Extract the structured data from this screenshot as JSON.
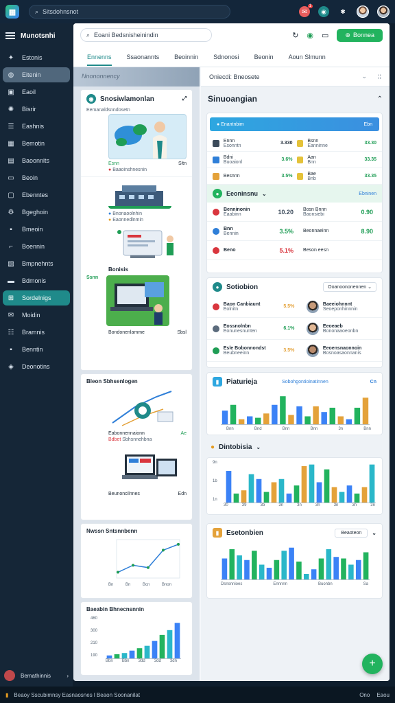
{
  "topbar": {
    "search_text": "Sitsdohnsnot",
    "notif_count": "1"
  },
  "sidebar": {
    "title": "Munotsnhi",
    "items": [
      {
        "label": "Estonis",
        "icon": "chart-icon"
      },
      {
        "label": "Eitenin",
        "icon": "circle-icon"
      },
      {
        "label": "Eaoil",
        "icon": "card-icon"
      },
      {
        "label": "Bisrir",
        "icon": "lightbulb-icon"
      },
      {
        "label": "Eashnis",
        "icon": "list-icon"
      },
      {
        "label": "Bemotin",
        "icon": "calendar-icon"
      },
      {
        "label": "Baoonnits",
        "icon": "doc-icon"
      },
      {
        "label": "Beoin",
        "icon": "monitor-icon"
      },
      {
        "label": "Ebenntes",
        "icon": "file-icon"
      },
      {
        "label": "Bgeghoin",
        "icon": "cog-icon"
      },
      {
        "label": "Bmeoin",
        "icon": "box-icon"
      },
      {
        "label": "Boennin",
        "icon": "key-icon"
      },
      {
        "label": "Bmpnehnts",
        "icon": "image-icon"
      },
      {
        "label": "Bdmonis",
        "icon": "folder-icon"
      },
      {
        "label": "Sordelnigs",
        "icon": "graph-icon"
      },
      {
        "label": "Moidin",
        "icon": "mail-icon"
      },
      {
        "label": "Bramnis",
        "icon": "users-icon"
      },
      {
        "label": "Benntin",
        "icon": "box-icon"
      },
      {
        "label": "Deonotins",
        "icon": "tag-icon"
      }
    ],
    "footer_label": "Bemathinnis"
  },
  "main": {
    "search_text": "Eoani Bedsnisheinindin",
    "action_button": "Bonnea",
    "tabs": [
      "Ennenns",
      "Ssaonannts",
      "Beoinnin",
      "Sdnonosi",
      "Beonin",
      "Aoun Slmunn"
    ],
    "left_banner": "Nnononnency",
    "right_header": "Oniecdi: Bneosete",
    "left_card_title": "Snosiwlamonlan",
    "left_items": [
      {
        "caption": "Eemanaldsnndosetn",
        "value": "Esnn",
        "sub": "Baaoinshnesnin",
        "sub2": "Sltn"
      },
      {
        "caption": "Bnonaoolnhin",
        "sub": "Eaonnedlnmin"
      },
      {
        "caption": "Bonisis"
      },
      {
        "caption": "Ssnn",
        "value": "Nnntsnonin",
        "sub": "Bondonenlamme",
        "sub2": "Sbsl"
      }
    ],
    "left_card2_title": "Bleon Sbhsenlogen",
    "left_card2_caption": "Eabonnennaionn",
    "left_card2_value": "Ae",
    "left_card2_sub": "Sbhsnnehbna",
    "left_card2_sub2": "Bdbet",
    "left_card3_caption": "Beunoncilnnes",
    "left_card3_value": "Edn",
    "left_card4_title": "Nwssn Sntsnnbenn",
    "left_card4_xlabels": [
      "Bn",
      "Bn",
      "Bcn",
      "Bnon"
    ],
    "left_card5_title": "Baeabin Bhnecnsnnin",
    "left_card5_ylabels": [
      "460",
      "300",
      "210",
      "190"
    ],
    "left_card5_xlabels": [
      "Bbn",
      "Bbn",
      "3dd",
      "3dd",
      "3dn"
    ],
    "right_title": "Sinuoangian",
    "table1": {
      "header": "Enantnbim",
      "header_right": "Ebn",
      "rows": [
        {
          "a": "Ennn",
          "b": "Esonntn",
          "v1": "3.330",
          "c": "Bsnn",
          "d": "Eanninne",
          "v2": "33.30"
        },
        {
          "a": "Bdni",
          "b": "Buoaionl",
          "v1": "3.6%",
          "c": "Aan",
          "d": "Bnn",
          "v2": "33.35"
        },
        {
          "a": "Besnnn",
          "b": "",
          "v1": "3.5%",
          "c": "Bae",
          "d": "Bnb",
          "v2": "33.35"
        }
      ]
    },
    "table2": {
      "title": "Eeoninsnu",
      "header_right": "Ebninen",
      "rows": [
        {
          "a": "Benninonin",
          "b": "Eaabinn",
          "v1": "10.20",
          "c": "Bosn Bnnn",
          "d": "Baonsiebi",
          "v2": "0.90"
        },
        {
          "a": "Bnn",
          "b": "Bennin",
          "v1": "3.5%",
          "c": "Beonnaeinn",
          "d": "",
          "v2": "8.90"
        },
        {
          "a": "Beno",
          "b": "",
          "v1": "5.1%",
          "c": "Beson eesn",
          "d": "",
          "v2": ""
        }
      ]
    },
    "table3": {
      "title": "Sotiobion",
      "dropdown": "Ooanoononennen",
      "rows": [
        {
          "a": "Baon Canbiaunt",
          "b": "Eolnitn",
          "v1": "5.5%",
          "name": "Baeeiohnnnt",
          "sub": "Seoeponhinnnin"
        },
        {
          "a": "Eossnolnbn",
          "b": "Eonunesnunten",
          "v1": "6.1%",
          "name": "Eeoeaeb",
          "sub": "Bononaaoeonbn"
        },
        {
          "a": "Esle Bobonnondst",
          "b": "Beubneeinn",
          "v1": "3.5%",
          "name": "Eeoensnaonnoin",
          "sub": "Bosnoasaonnanis"
        }
      ]
    },
    "chart1": {
      "title": "Piaturieja",
      "subtitle": "Sobohgontioinatinnen",
      "tag": "Cn",
      "xlabels": [
        "Bnn",
        "Bnd",
        "Bnn",
        "Bnn",
        "3n",
        "Bnn"
      ]
    },
    "chart2": {
      "title": "Dintobisia",
      "xlabels": [
        "30",
        "39",
        "3b",
        "3n",
        "3n",
        "3n",
        "3n",
        "3n",
        "3n"
      ],
      "ylabels": [
        "9n",
        "1b",
        "1n"
      ]
    },
    "chart3": {
      "title": "Esetonbien",
      "dropdown": "Beaoteon",
      "xlabels": [
        "Dsnsnnioes",
        "Ennnnn",
        "Buonbn",
        "Sa"
      ]
    }
  },
  "status": {
    "left": "Beaoy Sscubimnsy Easnaosnes l Beaon Soonanilat",
    "right": [
      "Ono",
      "Eaou"
    ]
  },
  "chart_data": [
    {
      "type": "bar",
      "title": "Piaturieja",
      "categories": [
        "1",
        "2",
        "3",
        "4",
        "5",
        "6",
        "7",
        "8",
        "9",
        "10",
        "11",
        "12",
        "13",
        "14",
        "15",
        "16",
        "17",
        "18"
      ],
      "series": [
        {
          "values": [
            20,
            28,
            8,
            12,
            10,
            16,
            28,
            40,
            14,
            26,
            12,
            26,
            18,
            24,
            12,
            8,
            24,
            38
          ]
        }
      ],
      "colors": [
        "#3b82f6",
        "#22b35e",
        "#e4a23a"
      ]
    },
    {
      "type": "bar",
      "title": "Dintobisia",
      "categories": [
        "1",
        "2",
        "3",
        "4",
        "5",
        "6",
        "7",
        "8",
        "9",
        "10",
        "11",
        "12",
        "13",
        "14",
        "15",
        "16",
        "17",
        "18",
        "19",
        "20"
      ],
      "series": [
        {
          "values": [
            40,
            12,
            16,
            36,
            30,
            14,
            26,
            30,
            12,
            22,
            46,
            48,
            26,
            42,
            20,
            14,
            22,
            12,
            20,
            48
          ]
        }
      ],
      "colors": [
        "#3b82f6",
        "#22b35e",
        "#e4a23a",
        "#2ab7c9"
      ]
    },
    {
      "type": "bar",
      "title": "Esetonbien",
      "categories": [
        "1",
        "2",
        "3",
        "4",
        "5",
        "6",
        "7",
        "8",
        "9",
        "10",
        "11",
        "12",
        "13",
        "14",
        "15",
        "16",
        "17",
        "18",
        "19",
        "20"
      ],
      "series": [
        {
          "values": [
            28,
            40,
            32,
            26,
            38,
            20,
            16,
            26,
            38,
            42,
            24,
            8,
            14,
            28,
            40,
            30,
            28,
            20,
            26,
            36
          ]
        }
      ],
      "colors": [
        "#3b82f6",
        "#22b35e",
        "#2ab7c9"
      ]
    },
    {
      "type": "line",
      "title": "Nwssn Sntsnnbenn",
      "x": [
        1,
        2,
        3,
        4,
        5
      ],
      "y": [
        10,
        22,
        18,
        48,
        58
      ]
    },
    {
      "type": "bar",
      "title": "Baeabin Bhnecnsnnin",
      "categories": [
        "1",
        "2",
        "3",
        "4",
        "5",
        "6",
        "7",
        "8",
        "9",
        "10"
      ],
      "series": [
        {
          "values": [
            6,
            8,
            10,
            14,
            18,
            22,
            30,
            40,
            48,
            60
          ]
        }
      ],
      "colors": [
        "#3b82f6",
        "#22b35e",
        "#2ab7c9"
      ]
    }
  ]
}
